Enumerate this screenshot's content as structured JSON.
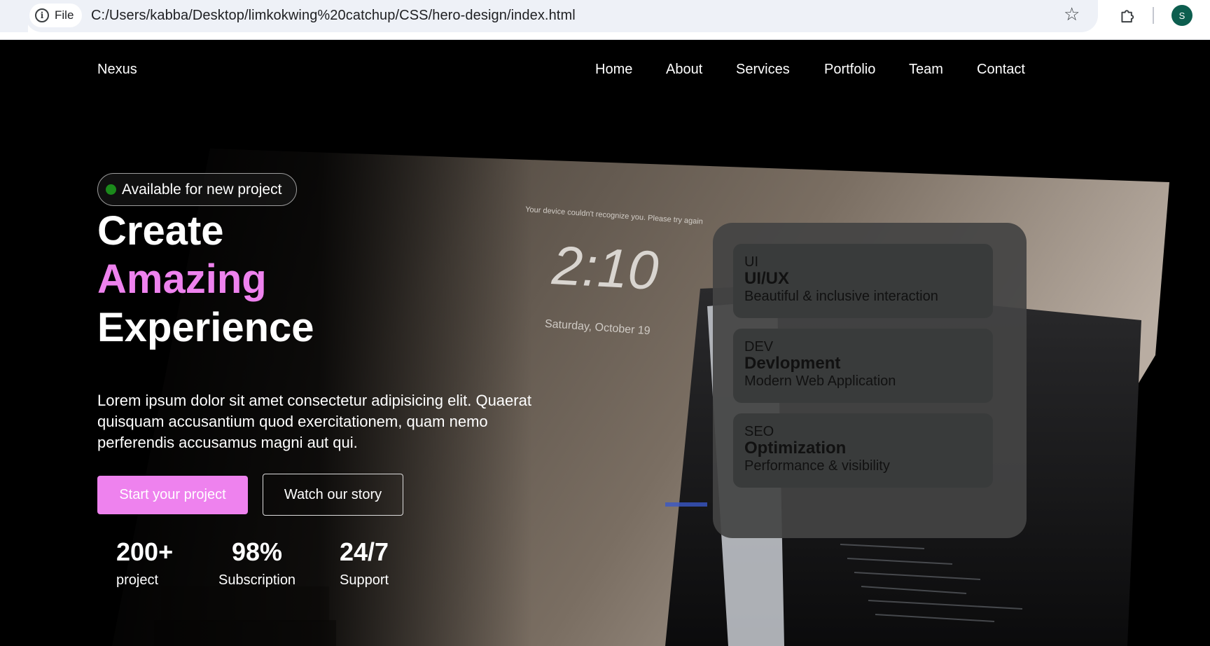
{
  "browser": {
    "chip_label": "File",
    "url": "C:/Users/kabba/Desktop/limkokwing%20catchup/CSS/hero-design/index.html",
    "avatar_initial": "S"
  },
  "site": {
    "brand": "Nexus",
    "nav": [
      "Home",
      "About",
      "Services",
      "Portfolio",
      "Team",
      "Contact"
    ]
  },
  "hero": {
    "badge": "Available for new project",
    "headline": [
      "Create",
      "Amazing",
      "Experience"
    ],
    "description": "Lorem ipsum dolor sit amet consectetur adipisicing elit. Quaerat quisquam accusantium quod exercitationem, quam nemo perferendis accusamus magni aut qui.",
    "primary_cta": "Start your project",
    "secondary_cta": "Watch our story",
    "stats": [
      {
        "value": "200+",
        "label": "project"
      },
      {
        "value": "98%",
        "label": "Subscription"
      },
      {
        "value": "24/7",
        "label": "Support"
      }
    ]
  },
  "background_photo": {
    "clock_time": "2:10",
    "clock_date": "Saturday, October 19",
    "lock_message": "Your device couldn't recognize you. Please try again"
  },
  "services": [
    {
      "tag": "UI",
      "title": "UI/UX",
      "subtitle": "Beautiful & inclusive interaction"
    },
    {
      "tag": "DEV",
      "title": "Devlopment",
      "subtitle": "Modern Web Application"
    },
    {
      "tag": "SEO",
      "title": "Optimization",
      "subtitle": "Performance & visibility"
    }
  ],
  "colors": {
    "accent": "#ee82ee",
    "status_dot": "#1b8a1b",
    "panel": "#444444",
    "card": "#393b3b",
    "avatar": "#0d5e4f"
  }
}
